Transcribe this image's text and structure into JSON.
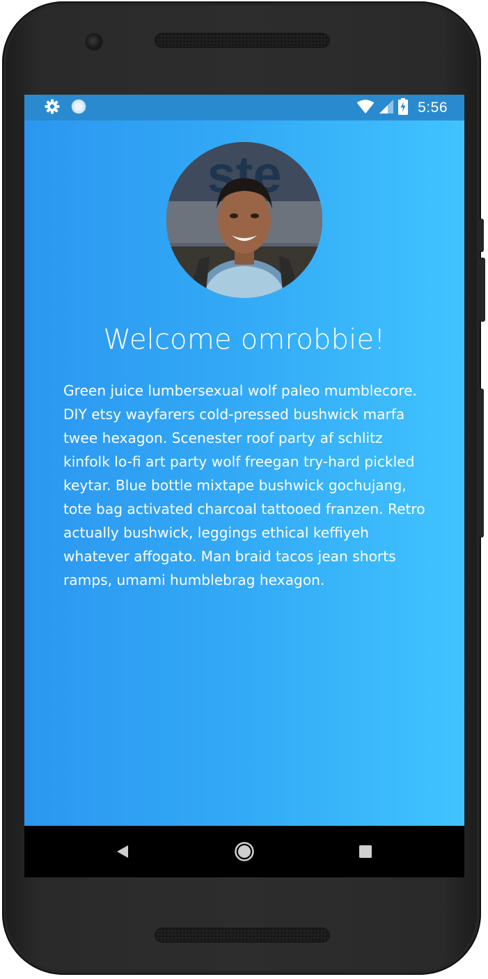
{
  "status_bar": {
    "time": "5:56",
    "left_icons": [
      "gear-icon",
      "sync-icon"
    ],
    "right_icons": [
      "wifi-icon",
      "cell-signal-icon",
      "battery-charging-icon"
    ]
  },
  "profile": {
    "avatar_icon": "avatar",
    "avatar_text": "ste",
    "welcome": "Welcome omrobbie!",
    "body": "Green juice lumbersexual wolf paleo mumblecore. DIY etsy wayfarers cold-pressed bushwick marfa twee hexagon. Scenester roof party af schlitz kinfolk lo-fi art party wolf freegan try-hard pickled keytar. Blue bottle mixtape bushwick gochujang, tote bag activated charcoal tattooed franzen. Retro actually bushwick, leggings ethical keffiyeh whatever affogato. Man braid tacos jean shorts ramps, umami humblebrag hexagon."
  },
  "nav_bar": {
    "buttons": [
      "back-icon",
      "home-icon",
      "recents-icon"
    ]
  },
  "colors": {
    "status_bar": "#2a8ad0",
    "gradient_start": "#2b97f0",
    "gradient_end": "#40c3ff",
    "text": "#ffffff",
    "nav_bar": "#000000",
    "device_body": "#2d2d2d"
  }
}
